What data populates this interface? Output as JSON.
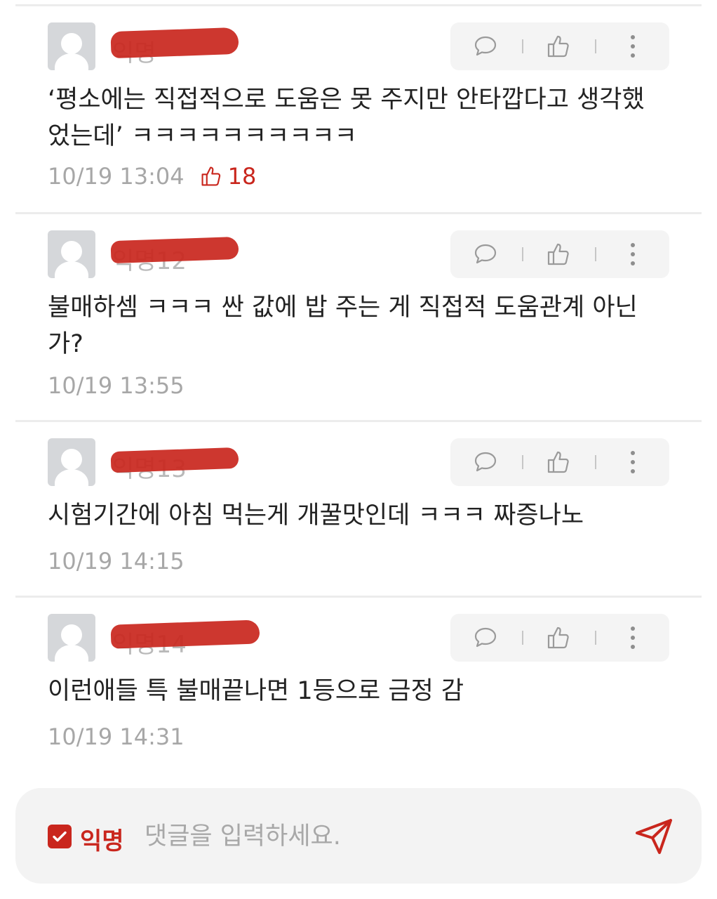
{
  "comments": [
    {
      "author": "익명",
      "text": "‘평소에는 직접적으로 도움은 못 주지만 안타깝다고 생각했었는데’ ㅋㅋㅋㅋㅋㅋㅋㅋㅋㅋ",
      "time": "10/19 13:04",
      "likes": "18"
    },
    {
      "author": "익명12",
      "text": "불매하셈 ㅋㅋㅋ 싼 값에 밥 주는 게 직접적 도움관계 아닌가?",
      "time": "10/19 13:55",
      "likes": ""
    },
    {
      "author": "익명13",
      "text": "시험기간에 아침 먹는게 개꿀맛인데 ㅋㅋㅋ 짜증나노",
      "time": "10/19 14:15",
      "likes": ""
    },
    {
      "author": "익명14",
      "text": "이런애들 특 불매끝나면 1등으로 금정 감",
      "time": "10/19 14:31",
      "likes": ""
    }
  ],
  "icons": {
    "reply": "speech-bubble-icon",
    "like": "thumbs-up-icon",
    "more": "vertical-dots-icon",
    "send": "paper-plane-icon"
  },
  "input_bar": {
    "anonymous_label": "익명",
    "anonymous_checked": true,
    "placeholder": "댓글을 입력하세요."
  },
  "colors": {
    "accent": "#c9261d",
    "meta_gray": "#a7a7a7",
    "divider": "#ececec"
  }
}
